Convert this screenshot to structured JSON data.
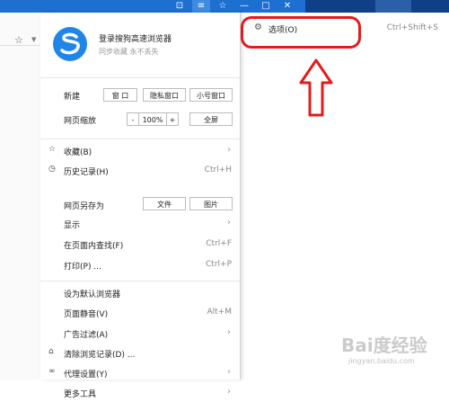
{
  "colors": {
    "accent": "#1d6fd0",
    "annotation_red": "#e21c1c",
    "logo_blue": "#1f86e8"
  },
  "account": {
    "title": "登录搜狗高速浏览器",
    "subtitle": "同步收藏 永不丢失"
  },
  "new_row": {
    "label": "新建",
    "buttons": [
      "窗 口",
      "隐私窗口",
      "小号窗口"
    ]
  },
  "zoom_row": {
    "label": "网页缩放",
    "minus": "-",
    "value": "100%",
    "plus": "+",
    "fullscreen": "全屏"
  },
  "save_row": {
    "label": "网页另存为",
    "buttons": [
      "文件",
      "图片"
    ]
  },
  "menu_items": [
    {
      "label": "收藏(B)",
      "shortcut": "",
      "icon": "star-icon",
      "arrow": true
    },
    {
      "label": "历史记录(H)",
      "shortcut": "Ctrl+H",
      "icon": "clock-icon",
      "arrow": false
    },
    {
      "label": "显示",
      "shortcut": "",
      "icon": "",
      "arrow": true
    },
    {
      "label": "在页面内查找(F)",
      "shortcut": "Ctrl+F",
      "icon": "",
      "arrow": false
    },
    {
      "label": "打印(P) ...",
      "shortcut": "Ctrl+P",
      "icon": "",
      "arrow": false
    },
    {
      "label": "设为默认浏览器",
      "shortcut": "",
      "icon": "",
      "arrow": false
    },
    {
      "label": "页面静音(V)",
      "shortcut": "Alt+M",
      "icon": "",
      "arrow": false
    },
    {
      "label": "广告过滤(A)",
      "shortcut": "",
      "icon": "",
      "arrow": true
    },
    {
      "label": "清除浏览记录(D) ...",
      "shortcut": "",
      "icon": "broom-icon",
      "arrow": false
    },
    {
      "label": "代理设置(Y)",
      "shortcut": "",
      "icon": "link-icon",
      "arrow": true
    },
    {
      "label": "更多工具",
      "shortcut": "",
      "icon": "",
      "arrow": true
    }
  ],
  "options": {
    "label": "选项(O)",
    "shortcut": "Ctrl+Shift+S"
  },
  "titlebar": {
    "buttons": [
      "⊡",
      "≡",
      "☆",
      "—",
      "□",
      "✕"
    ]
  },
  "watermark": {
    "main": "Bai度经验",
    "sub": "jingyan.baidu.com"
  }
}
